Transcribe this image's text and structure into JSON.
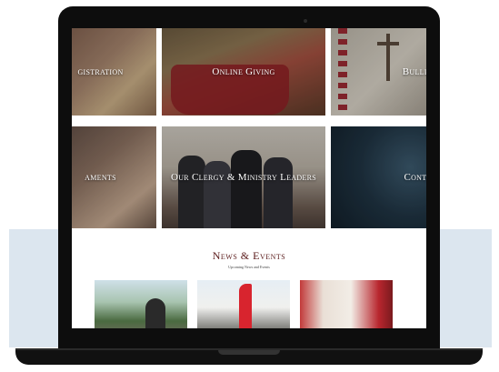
{
  "tiles": {
    "registration": "gistration",
    "giving": "Online Giving",
    "bulletin": "Bulleti",
    "sacraments": "aments",
    "clergy": "Our Clergy & Ministry Leaders",
    "contact": "Contac"
  },
  "news": {
    "title": "News & Events",
    "subtitle": "Upcoming News and Events"
  },
  "colors": {
    "laptop": "#0d0d0d",
    "background_band": "#dce6ef",
    "accent": "#5a1a1a"
  }
}
